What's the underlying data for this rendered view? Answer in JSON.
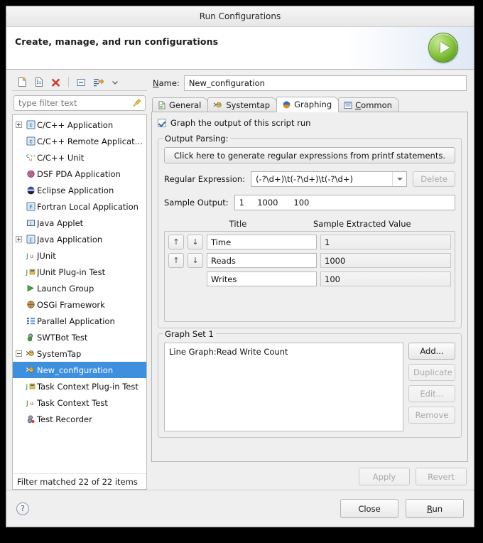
{
  "window": {
    "title": "Run Configurations"
  },
  "banner": {
    "headline": "Create, manage, and run configurations",
    "icon": "run-play-icon"
  },
  "left_toolbar": {
    "buttons": [
      {
        "name": "new-launch-configuration",
        "icon": "new-file-icon"
      },
      {
        "name": "duplicate-launch-configuration",
        "icon": "copy-file-icon"
      },
      {
        "name": "delete-launch-configuration",
        "icon": "red-x-icon"
      },
      {
        "name": "collapse-all",
        "icon": "collapse-all-icon"
      },
      {
        "name": "filter-launch-configurations",
        "icon": "filter-arrow-icon"
      },
      {
        "name": "view-menu",
        "icon": "chevron-down-icon"
      }
    ]
  },
  "filter": {
    "placeholder": "type filter text",
    "value": "",
    "clear_icon": "broom-icon"
  },
  "tree": {
    "items": [
      {
        "label": "C/C++ Application",
        "indent": 0,
        "twisty": "plus",
        "icon": "c-app-icon",
        "selected": false
      },
      {
        "label": "C/C++ Remote Application",
        "indent": 0,
        "twisty": "none",
        "icon": "c-app-icon",
        "selected": false
      },
      {
        "label": "C/C++ Unit",
        "indent": 0,
        "twisty": "none",
        "icon": "cpp-unit-icon",
        "selected": false
      },
      {
        "label": "DSF PDA Application",
        "indent": 0,
        "twisty": "none",
        "icon": "dsf-pda-icon",
        "selected": false
      },
      {
        "label": "Eclipse Application",
        "indent": 0,
        "twisty": "none",
        "icon": "eclipse-icon",
        "selected": false
      },
      {
        "label": "Fortran Local Application",
        "indent": 0,
        "twisty": "none",
        "icon": "fortran-icon",
        "selected": false
      },
      {
        "label": "Java Applet",
        "indent": 0,
        "twisty": "none",
        "icon": "java-applet-icon",
        "selected": false
      },
      {
        "label": "Java Application",
        "indent": 0,
        "twisty": "plus",
        "icon": "java-app-icon",
        "selected": false
      },
      {
        "label": "JUnit",
        "indent": 0,
        "twisty": "none",
        "icon": "junit-icon",
        "selected": false
      },
      {
        "label": "JUnit Plug-in Test",
        "indent": 0,
        "twisty": "none",
        "icon": "junit-plugin-icon",
        "selected": false
      },
      {
        "label": "Launch Group",
        "indent": 0,
        "twisty": "none",
        "icon": "launch-group-icon",
        "selected": false
      },
      {
        "label": "OSGi Framework",
        "indent": 0,
        "twisty": "none",
        "icon": "osgi-icon",
        "selected": false
      },
      {
        "label": "Parallel Application",
        "indent": 0,
        "twisty": "none",
        "icon": "parallel-icon",
        "selected": false
      },
      {
        "label": "SWTBot Test",
        "indent": 0,
        "twisty": "none",
        "icon": "swtbot-icon",
        "selected": false
      },
      {
        "label": "SystemTap",
        "indent": 0,
        "twisty": "minus",
        "icon": "systemtap-icon",
        "selected": false
      },
      {
        "label": "New_configuration",
        "indent": 1,
        "twisty": "none",
        "icon": "systemtap-icon",
        "selected": true
      },
      {
        "label": "Task Context Plug-in Test",
        "indent": 0,
        "twisty": "none",
        "icon": "junit-plugin-icon",
        "selected": false
      },
      {
        "label": "Task Context Test",
        "indent": 0,
        "twisty": "none",
        "icon": "junit-icon",
        "selected": false
      },
      {
        "label": "Test Recorder",
        "indent": 0,
        "twisty": "none",
        "icon": "test-recorder-icon",
        "selected": false
      }
    ],
    "status": "Filter matched 22 of 22 items"
  },
  "name_row": {
    "label_prefix": "N",
    "label_rest": "ame:",
    "value": "New_configuration"
  },
  "tabs": [
    {
      "label": "General",
      "icon": "document-icon",
      "active": false,
      "mnemonic": ""
    },
    {
      "label": "Systemtap",
      "icon": "systemtap-icon",
      "active": false,
      "mnemonic": ""
    },
    {
      "label": "Graphing",
      "icon": "graphing-icon",
      "active": true,
      "mnemonic": ""
    },
    {
      "label": "Common",
      "icon": "common-icon",
      "active": false,
      "mnemonic": "C"
    }
  ],
  "graphing": {
    "graph_checkbox": {
      "label": "Graph the output of this script run",
      "checked": true
    },
    "output_parsing": {
      "legend": "Output Parsing:",
      "generate_button": "Click here to generate regular expressions from printf statements.",
      "regex_label": "Regular Expression:",
      "regex_value": "(-?\\d+)\\t(-?\\d+)\\t(-?\\d+)",
      "delete_button": "Delete",
      "sample_output_label": "Sample Output:",
      "sample_output_value": "1     1000      100",
      "columns": {
        "title": "Title",
        "value": "Sample Extracted Value"
      },
      "rows": [
        {
          "title": "Time",
          "value": "1",
          "up": "↑",
          "down": "↓",
          "has_up": true,
          "has_down": true
        },
        {
          "title": "Reads",
          "value": "1000",
          "up": "↑",
          "down": "↓",
          "has_up": true,
          "has_down": true
        },
        {
          "title": "Writes",
          "value": "100",
          "up": "",
          "down": "",
          "has_up": false,
          "has_down": false
        }
      ]
    },
    "graph_set": {
      "legend": "Graph Set 1",
      "items": [
        "Line Graph:Read Write Count"
      ],
      "buttons": [
        {
          "label": "Add...",
          "enabled": true
        },
        {
          "label": "Duplicate",
          "enabled": false
        },
        {
          "label": "Edit...",
          "enabled": false
        },
        {
          "label": "Remove",
          "enabled": false
        }
      ]
    }
  },
  "apply_row": [
    {
      "label": "Apply",
      "enabled": false
    },
    {
      "label": "Revert",
      "enabled": false
    }
  ],
  "footer": {
    "help_icon": "question-mark-icon",
    "close_button": "Close",
    "run_button_prefix": "R",
    "run_button_rest": "un"
  },
  "colors": {
    "selection_blue": "#3f8fdf",
    "run_green": "#8fc84a",
    "window_bg": "#efefef",
    "delete_red": "#d03b2f"
  }
}
